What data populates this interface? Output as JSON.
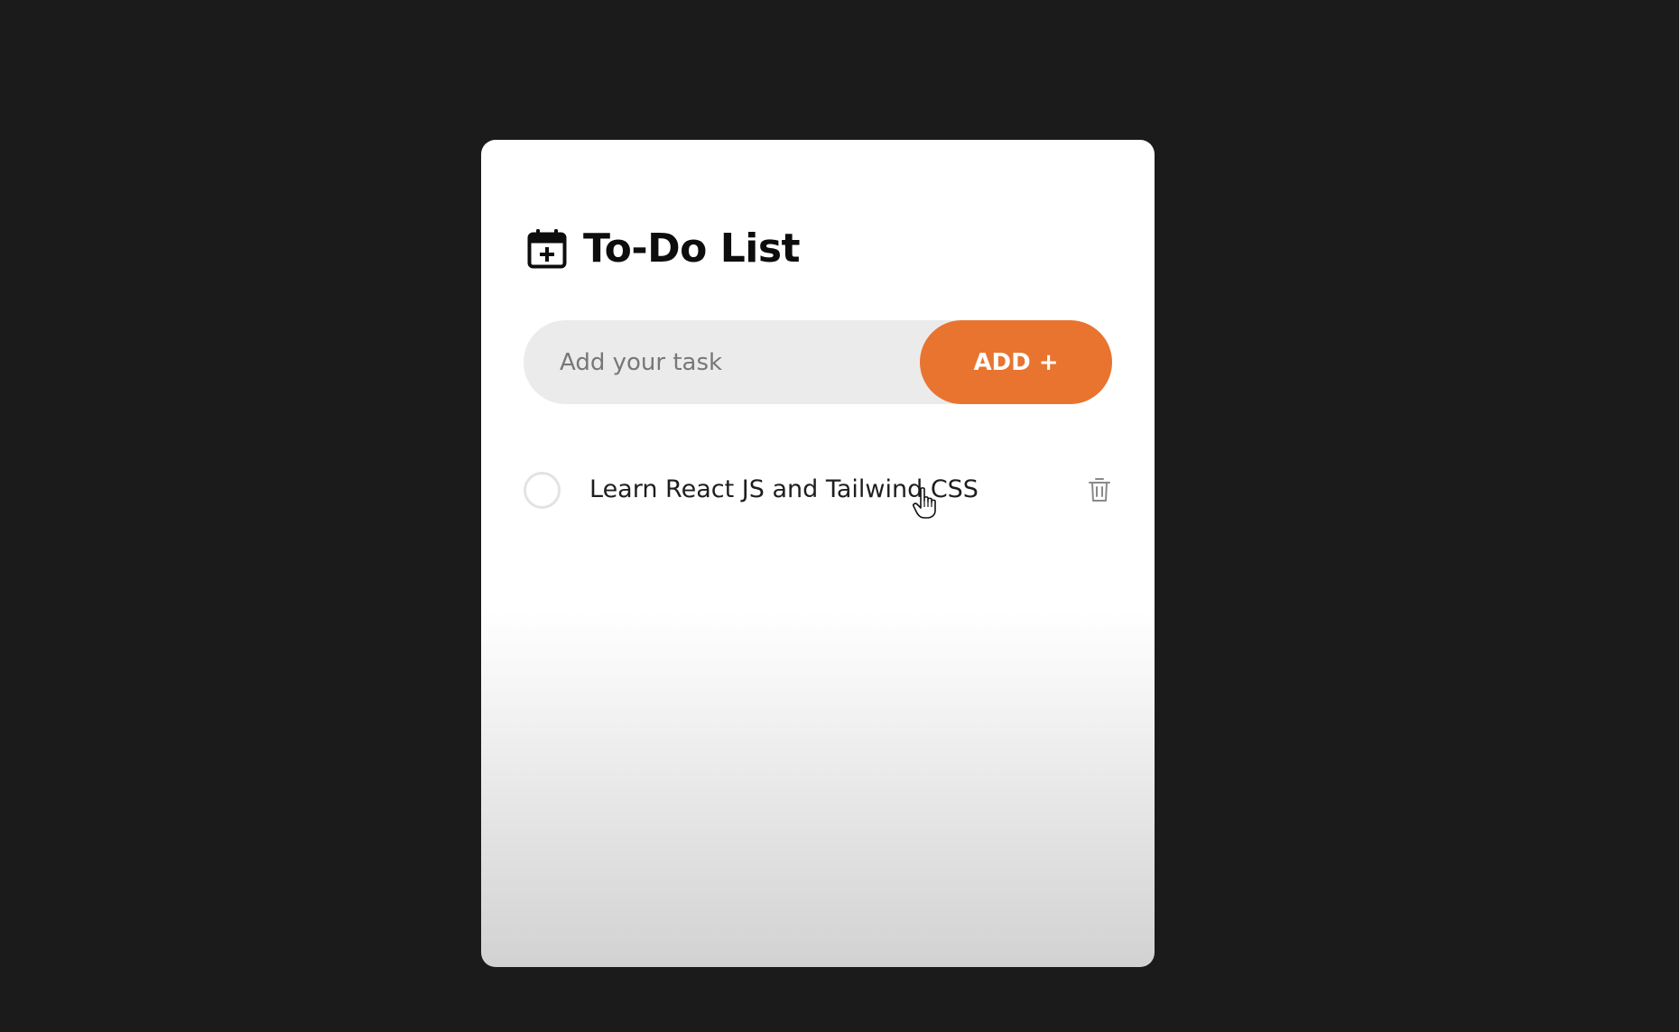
{
  "app": {
    "title": "To-Do List",
    "title_icon": "calendar-plus-icon"
  },
  "input": {
    "placeholder": "Add your task",
    "value": ""
  },
  "add_button": {
    "label": "ADD +"
  },
  "tasks": [
    {
      "text": "Learn React JS and Tailwind CSS",
      "completed": false,
      "check_icon": "circle-unchecked-icon",
      "delete_icon": "trash-icon"
    }
  ],
  "colors": {
    "background": "#1b1b1b",
    "card": "#ffffff",
    "accent": "#e87430",
    "input_bg": "#ebebeb"
  }
}
